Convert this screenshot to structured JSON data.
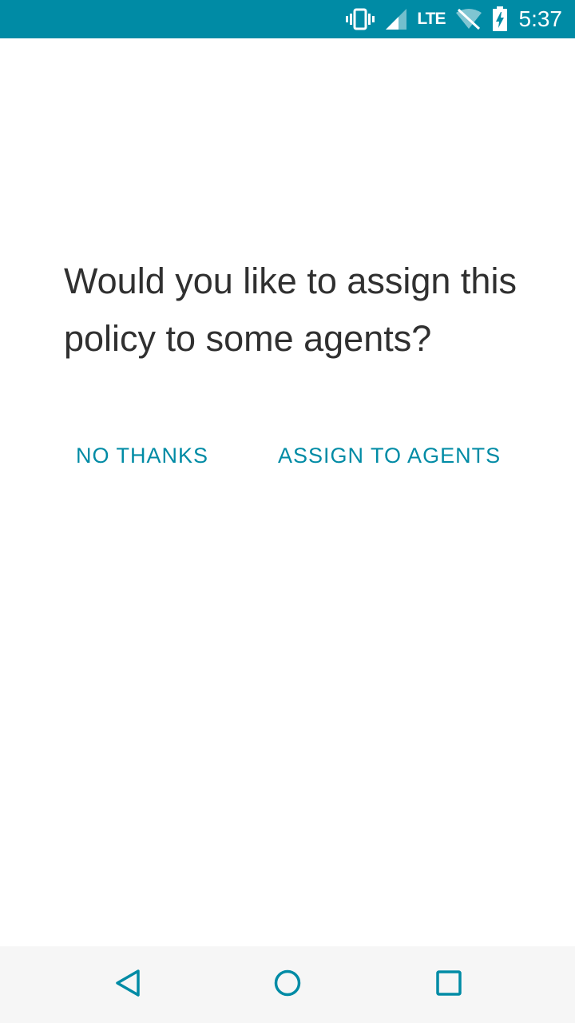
{
  "status_bar": {
    "network_label": "LTE",
    "time": "5:37",
    "icons": [
      "vibrate-icon",
      "cell-signal-icon",
      "wifi-off-icon",
      "battery-charging-icon"
    ],
    "background_color": "#008ba5"
  },
  "dialog": {
    "question": "Would you like to assign this policy to some agents?",
    "no_thanks_label": "NO THANKS",
    "assign_label": "ASSIGN TO AGENTS"
  },
  "nav_bar": {
    "icons": [
      "back-icon",
      "home-icon",
      "recents-icon"
    ],
    "icon_color": "#008ba5"
  },
  "colors": {
    "accent": "#008ba5",
    "text": "#303030",
    "background": "#ffffff",
    "nav_background": "#f6f6f6"
  }
}
